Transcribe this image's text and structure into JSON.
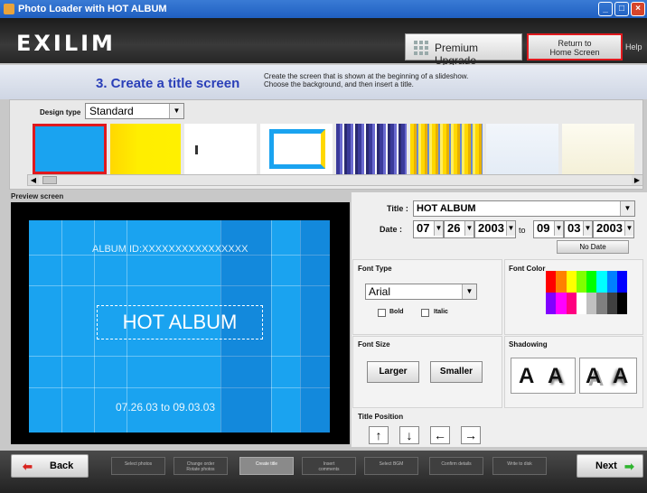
{
  "window": {
    "title": "Photo Loader with HOT ALBUM",
    "buttons": [
      "_",
      "□",
      "×"
    ]
  },
  "header": {
    "logo": "EXILIM",
    "premium_label": "Premium Upgrade",
    "home_label_1": "Return to",
    "home_label_2": "Home Screen",
    "help_label": "Help"
  },
  "step": {
    "title": "3. Create a title screen",
    "desc_1": "Create the screen that is shown at the beginning of a slideshow.",
    "desc_2": "Choose the background, and then insert a title."
  },
  "design": {
    "label": "Design type",
    "selected": "Standard"
  },
  "preview": {
    "label": "Preview screen",
    "album_id": "ALBUM ID:XXXXXXXXXXXXXXXX",
    "title": "HOT ALBUM",
    "date": "07.26.03 to 09.03.03"
  },
  "form": {
    "title_label": "Title :",
    "title_value": "HOT ALBUM",
    "date_label": "Date :",
    "from_month": "07",
    "from_day": "26",
    "from_year": "2003",
    "to_label": "to",
    "to_month": "09",
    "to_day": "03",
    "to_year": "2003",
    "no_date_label": "No Date"
  },
  "font_type": {
    "label": "Font Type",
    "value": "Arial",
    "bold_label": "Bold",
    "italic_label": "Italic"
  },
  "font_color": {
    "label": "Font Color",
    "palette": [
      "#ff0000",
      "#ff8000",
      "#ffff00",
      "#80ff00",
      "#00ff00",
      "#00ffff",
      "#0080ff",
      "#0000ff",
      "#8000ff",
      "#ff00ff",
      "#ff0080",
      "#ffffff",
      "#c0c0c0",
      "#808080",
      "#404040",
      "#000000"
    ]
  },
  "font_size": {
    "label": "Font Size",
    "larger": "Larger",
    "smaller": "Smaller"
  },
  "shadowing": {
    "label": "Shadowing",
    "glyph": "A"
  },
  "position": {
    "label": "Title Position",
    "up": "↑",
    "down": "↓",
    "left": "←",
    "right": "→"
  },
  "nav": {
    "back": "Back",
    "next": "Next",
    "steps": [
      {
        "l1": "Select photos",
        "l2": ""
      },
      {
        "l1": "Change order",
        "l2": "Rotate photos"
      },
      {
        "l1": "Create title",
        "l2": ""
      },
      {
        "l1": "Insert",
        "l2": "comments"
      },
      {
        "l1": "Select BGM",
        "l2": ""
      },
      {
        "l1": "Confirm details",
        "l2": ""
      },
      {
        "l1": "Write to disk",
        "l2": ""
      }
    ]
  },
  "colors": {
    "accent_red": "#e0191e",
    "preview_blue": "#1aa3f0",
    "step_title_blue": "#2a3fb8"
  }
}
